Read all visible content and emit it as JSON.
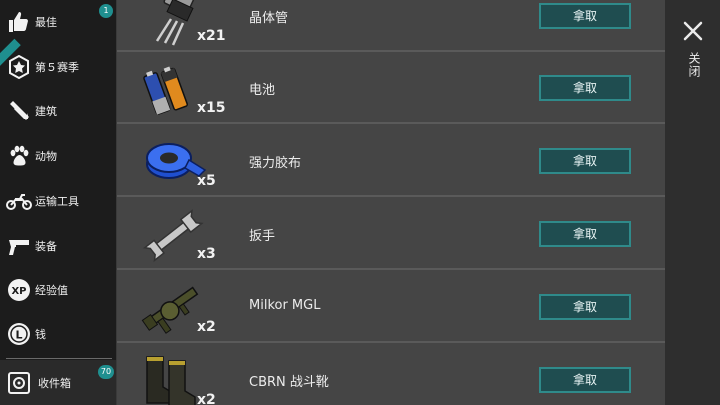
{
  "sidebar": {
    "items": [
      {
        "label": "最佳",
        "icon": "thumbs-up-icon",
        "badge": "1"
      },
      {
        "label": "第５赛季",
        "icon": "season-badge-icon"
      },
      {
        "label": "建筑",
        "icon": "build-tools-icon"
      },
      {
        "label": "动物",
        "icon": "paw-icon"
      },
      {
        "label": "运输工具",
        "icon": "motorcycle-icon"
      },
      {
        "label": "装备",
        "icon": "pistol-icon"
      },
      {
        "label": "经验值",
        "icon": "xp-icon",
        "icon_text": "XP"
      },
      {
        "label": "钱",
        "icon": "coin-icon",
        "icon_text": "L"
      },
      {
        "label": "收件箱",
        "icon": "inbox-safe-icon",
        "badge": "70"
      }
    ]
  },
  "items": [
    {
      "name": "晶体管",
      "qty": "x21",
      "icon": "transistor-icon",
      "button": "拿取"
    },
    {
      "name": "电池",
      "qty": "x15",
      "icon": "battery-icon",
      "button": "拿取"
    },
    {
      "name": "强力胶布",
      "qty": "x5",
      "icon": "duct-tape-icon",
      "button": "拿取"
    },
    {
      "name": "扳手",
      "qty": "x3",
      "icon": "wrench-icon",
      "button": "拿取"
    },
    {
      "name": "Milkor MGL",
      "qty": "x2",
      "icon": "grenade-launcher-icon",
      "button": "拿取"
    },
    {
      "name": "CBRN 战斗靴",
      "qty": "x2",
      "icon": "combat-boots-icon",
      "button": "拿取"
    }
  ],
  "close": {
    "label": "关闭",
    "icon": "close-icon"
  },
  "colors": {
    "accent": "#2f8a8a",
    "button_bg": "#1f4d50",
    "list_bg": "#454545",
    "sidebar_bg": "#1c1c1c"
  }
}
